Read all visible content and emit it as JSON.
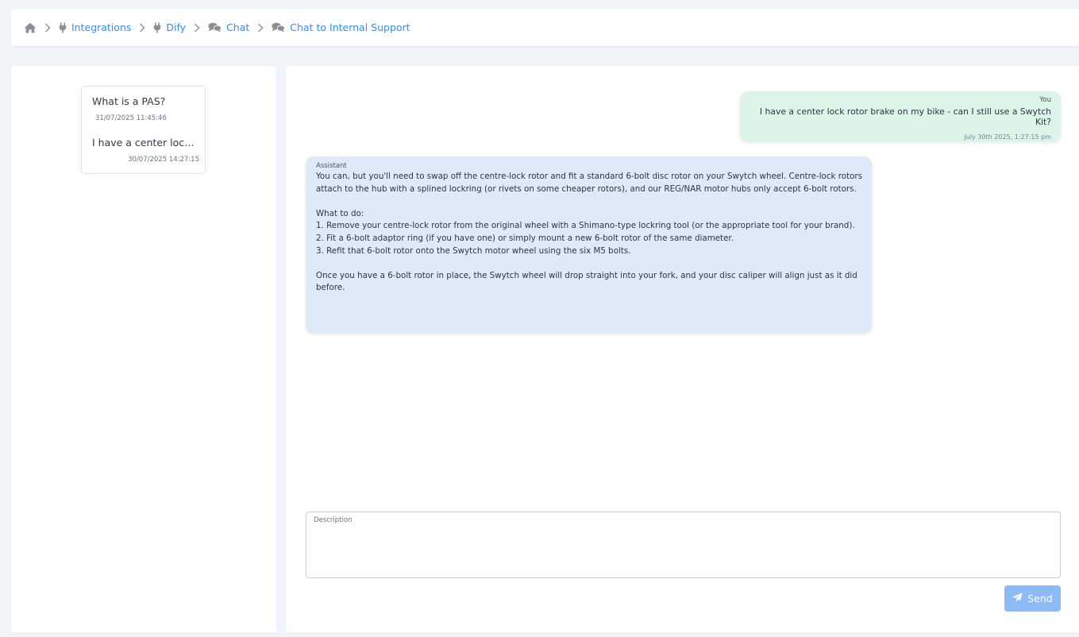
{
  "breadcrumb": {
    "home_icon": "home-icon",
    "items": [
      {
        "label": "Integrations",
        "icon": "plug-icon"
      },
      {
        "label": "Dify",
        "icon": "plug-icon"
      },
      {
        "label": "Chat",
        "icon": "chat-bubbles-icon"
      },
      {
        "label": "Chat to Internal Support",
        "icon": "chat-bubbles-icon"
      }
    ]
  },
  "history": [
    {
      "title": "What is a PAS?",
      "date": "31/07/2025 11:45:46"
    },
    {
      "title": "I have a center lock rotor brake on my bike - can I still use a Swytch Kit?",
      "date": "30/07/2025 14:27:15"
    }
  ],
  "messages": {
    "user": {
      "sender": "You",
      "text": "I have a center lock rotor brake on my bike - can I still use a Swytch Kit?",
      "timestamp": "July 30th 2025, 1:27:15 pm"
    },
    "assistant": {
      "sender": "Assistant",
      "lines": [
        "You can, but you'll need to swap off the centre-lock rotor and fit a standard 6-bolt disc rotor on your Swytch wheel. Centre-lock rotors attach to the hub with a splined lockring (or rivets on some cheaper rotors), and our REG/NAR motor hubs only accept 6-bolt rotors.",
        "",
        "What to do:",
        "1. Remove your centre-lock rotor from the original wheel with a Shimano-type lockring tool (or the appropriate tool for your brand).",
        "2. Fit a 6-bolt adaptor ring (if you have one) or simply mount a new 6-bolt rotor of the same diameter.",
        "3. Refit that 6-bolt rotor onto the Swytch motor wheel using the six M5 bolts.",
        "",
        "Once you have a 6-bolt rotor in place, the Swytch wheel will drop straight into your fork, and your disc caliper will align just as it did before."
      ]
    }
  },
  "composer": {
    "label": "Description",
    "value": "",
    "send_label": "Send"
  },
  "colors": {
    "accent": "#3d8be0",
    "user_bubble": "#ddf4e9",
    "assistant_bubble": "#dfeaf9",
    "send_button": "#8dbbf8"
  }
}
